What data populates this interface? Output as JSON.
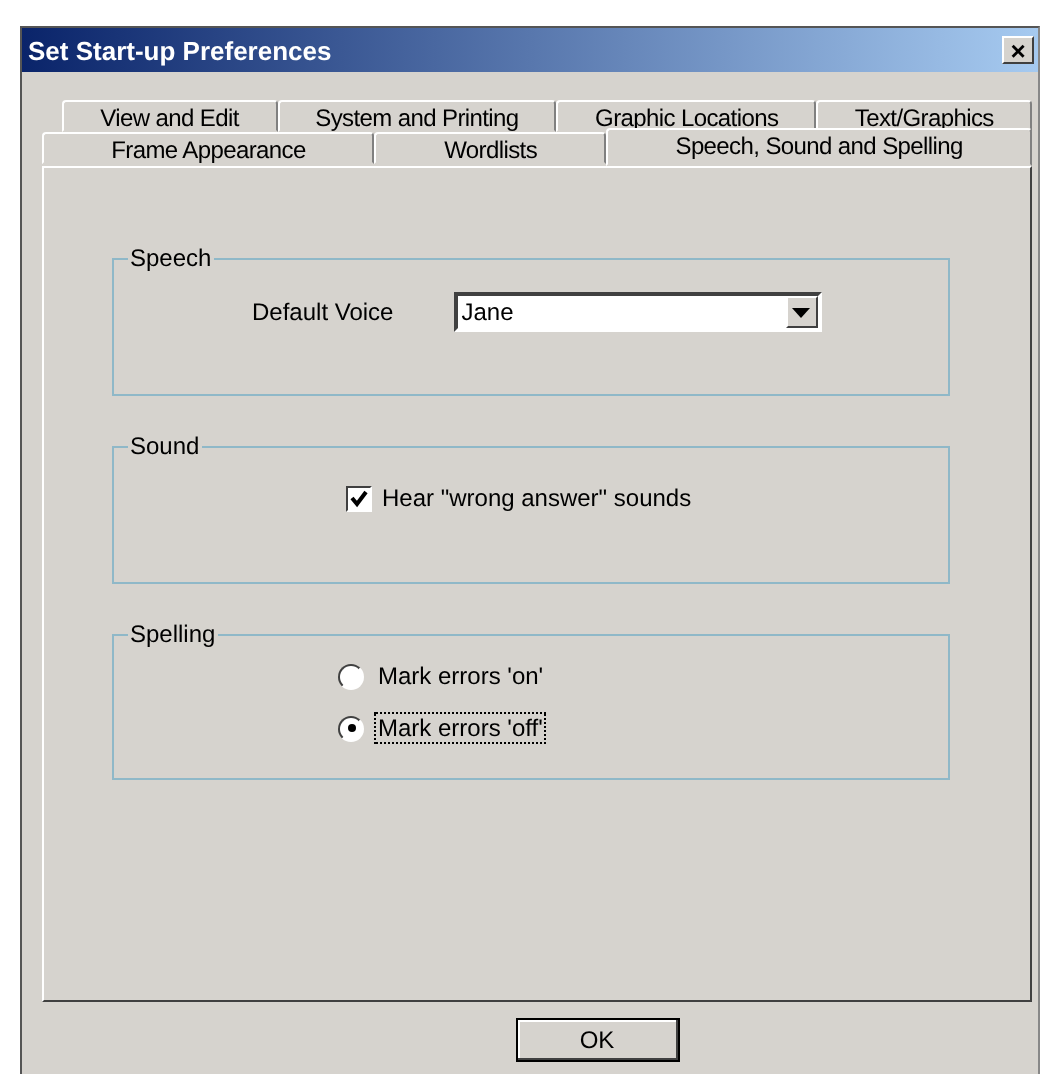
{
  "window": {
    "title": "Set Start-up Preferences",
    "close": "×"
  },
  "tab_rows": [
    [
      {
        "label": "View and Edit",
        "selected": false
      },
      {
        "label": "System and Printing",
        "selected": false
      },
      {
        "label": "Graphic Locations",
        "selected": false
      },
      {
        "label": "Text/Graphics",
        "selected": false
      }
    ],
    [
      {
        "label": "Frame Appearance",
        "selected": false
      },
      {
        "label": "Wordlists",
        "selected": false
      },
      {
        "label": "Speech, Sound and Spelling",
        "selected": true
      }
    ]
  ],
  "groups": [
    {
      "kind": "dropdown",
      "title": "Speech",
      "label": "Default Voice",
      "value": "Jane"
    },
    {
      "kind": "checkbox",
      "title": "Sound",
      "label": "Hear \"wrong answer\" sounds",
      "checked": true
    },
    {
      "kind": "radios",
      "title": "Spelling",
      "options": [
        {
          "label": "Mark errors 'on'",
          "selected": false
        },
        {
          "label": "Mark errors 'off'",
          "selected": true
        }
      ]
    }
  ],
  "buttons": [
    "OK"
  ]
}
